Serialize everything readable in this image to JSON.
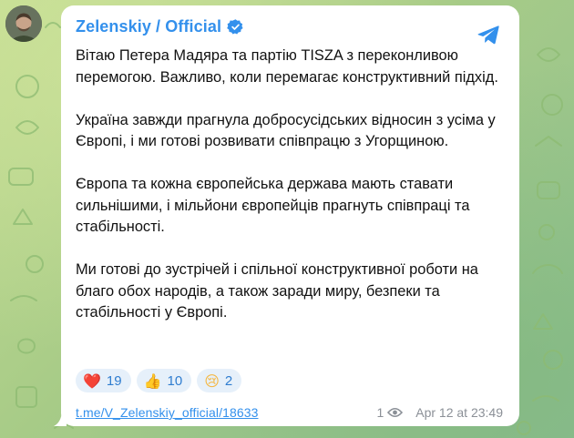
{
  "channel": {
    "name": "Zelenskiy / Official"
  },
  "message": {
    "paragraphs": [
      "Вітаю Петера Мадяра та партію TISZA з переконливою перемогою. Важливо, коли перемагає конструктивний підхід.",
      "Україна завжди прагнула добросусідських відносин з усіма у Європі, і ми готові розвивати співпрацю з Угорщиною.",
      "Європа та кожна європейська держава мають ставати сильнішими, і мільйони європейців прагнуть співпраці та стабільності.",
      "Ми готові до зустрічей і спільної конструктивної роботи на благо обох народів, а також заради миру, безпеки та стабільності у Європі."
    ]
  },
  "reactions": [
    {
      "emoji": "❤️",
      "count": "19"
    },
    {
      "emoji": "👍",
      "count": "10"
    },
    {
      "emoji": "😢",
      "count": "2"
    }
  ],
  "footer": {
    "link": "t.me/V_Zelenskiy_official/18633",
    "views": "1",
    "timestamp": "Apr 12 at 23:49"
  },
  "colors": {
    "accent": "#3390ec",
    "reaction_bg": "#e6f0fa",
    "meta": "#8b9097",
    "heart": "#e53935"
  },
  "icons": {
    "verified": "verified-badge-icon",
    "share": "share-icon",
    "views": "eye-icon"
  }
}
